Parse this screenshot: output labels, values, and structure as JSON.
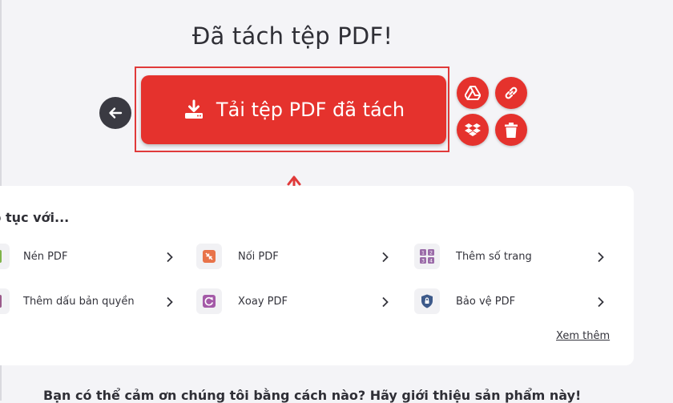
{
  "header": {
    "title": "Đã tách tệp PDF!"
  },
  "actions": {
    "download_label": "Tải tệp PDF đã tách",
    "back_icon": "arrow-left-icon",
    "side_icons": [
      "google-drive-icon",
      "link-icon",
      "dropbox-icon",
      "trash-icon"
    ]
  },
  "continue": {
    "heading": "p tục với...",
    "tools": [
      {
        "label": "Nén PDF",
        "icon": "compress-icon"
      },
      {
        "label": "Nối PDF",
        "icon": "merge-icon"
      },
      {
        "label": "Thêm số trang",
        "icon": "page-numbers-icon"
      },
      {
        "label": "Thêm dấu bản quyền",
        "icon": "watermark-icon"
      },
      {
        "label": "Xoay PDF",
        "icon": "rotate-icon"
      },
      {
        "label": "Bảo vệ PDF",
        "icon": "shield-icon"
      }
    ],
    "more_label": "Xem thêm"
  },
  "footer": {
    "text": "Bạn có thể cảm ơn chúng tôi bằng cách nào? Hãy giới thiệu sản phẩm này!"
  },
  "colors": {
    "accent": "#e5322d",
    "background": "#f4f4f7",
    "card": "#ffffff",
    "dark": "#3a3a42"
  }
}
